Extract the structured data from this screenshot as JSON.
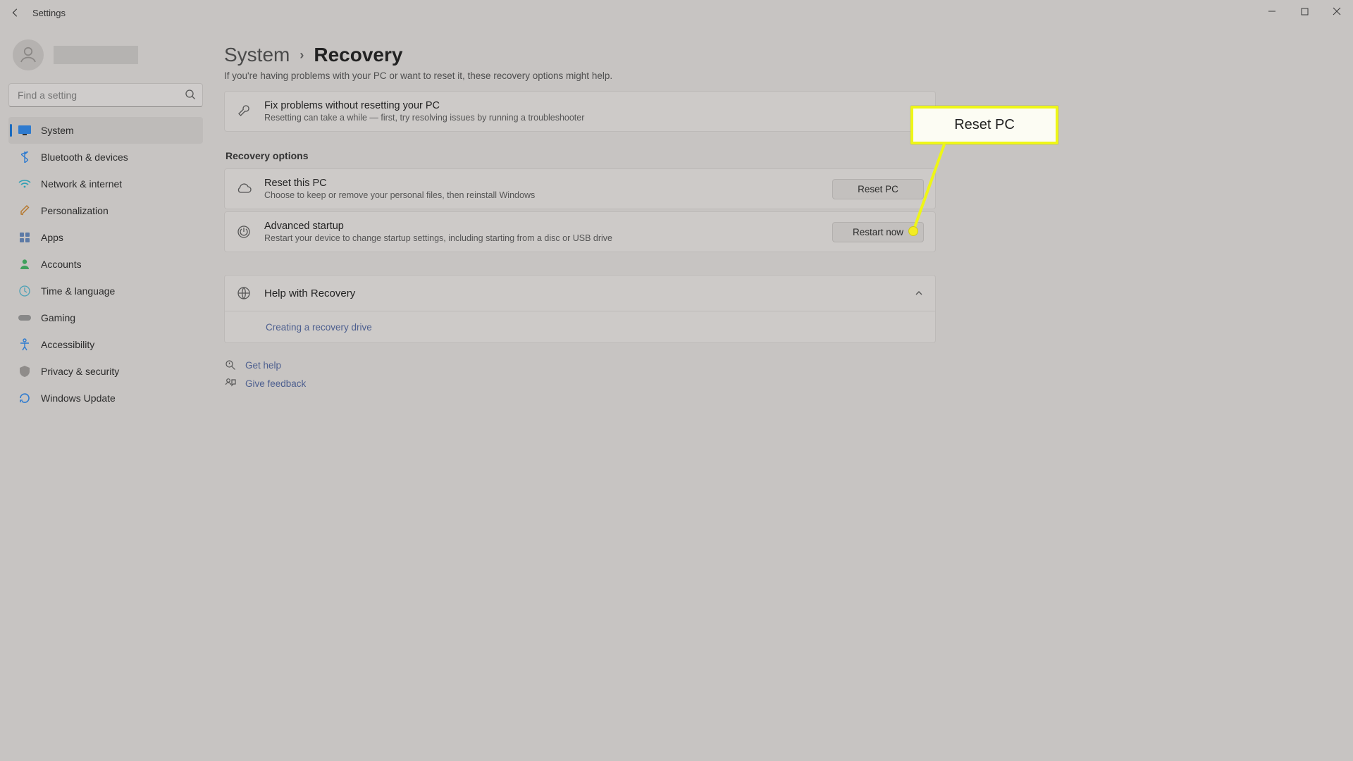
{
  "window": {
    "title": "Settings"
  },
  "breadcrumb": {
    "parent": "System",
    "current": "Recovery",
    "separator": "›"
  },
  "subtitle": "If you're having problems with your PC or want to reset it, these recovery options might help.",
  "search": {
    "placeholder": "Find a setting"
  },
  "sidebar": {
    "items": [
      {
        "label": "System",
        "selected": true
      },
      {
        "label": "Bluetooth & devices"
      },
      {
        "label": "Network & internet"
      },
      {
        "label": "Personalization"
      },
      {
        "label": "Apps"
      },
      {
        "label": "Accounts"
      },
      {
        "label": "Time & language"
      },
      {
        "label": "Gaming"
      },
      {
        "label": "Accessibility"
      },
      {
        "label": "Privacy & security"
      },
      {
        "label": "Windows Update"
      }
    ]
  },
  "cards": {
    "troubleshoot": {
      "title": "Fix problems without resetting your PC",
      "sub": "Resetting can take a while — first, try resolving issues by running a troubleshooter"
    },
    "section_label": "Recovery options",
    "reset": {
      "title": "Reset this PC",
      "sub": "Choose to keep or remove your personal files, then reinstall Windows",
      "button": "Reset PC"
    },
    "advanced": {
      "title": "Advanced startup",
      "sub": "Restart your device to change startup settings, including starting from a disc or USB drive",
      "button": "Restart now"
    }
  },
  "help": {
    "title": "Help with Recovery",
    "item": "Creating a recovery drive"
  },
  "footer": {
    "get_help": "Get help",
    "feedback": "Give feedback"
  },
  "annotation": {
    "label": "Reset PC"
  }
}
